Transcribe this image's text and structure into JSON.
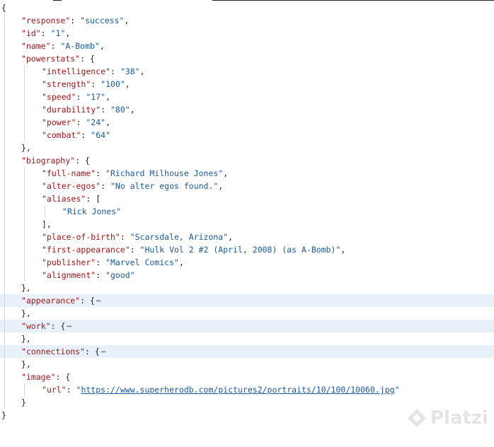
{
  "json_viewer": {
    "open_brace": "{",
    "close_brace": "}",
    "lines": [
      {
        "key": "response",
        "value": "success"
      },
      {
        "key": "id",
        "value": "1"
      },
      {
        "key": "name",
        "value": "A-Bomb"
      },
      {
        "key": "powerstats",
        "open": "{"
      },
      {
        "key": "intelligence",
        "value": "38"
      },
      {
        "key": "strength",
        "value": "100"
      },
      {
        "key": "speed",
        "value": "17"
      },
      {
        "key": "durability",
        "value": "80"
      },
      {
        "key": "power",
        "value": "24"
      },
      {
        "key": "combat",
        "value": "64"
      },
      {
        "close": "},"
      },
      {
        "key": "biography",
        "open": "{"
      },
      {
        "key": "full-name",
        "value": "Richard Milhouse Jones"
      },
      {
        "key": "alter-egos",
        "value": "No alter egos found."
      },
      {
        "key": "aliases",
        "open": "["
      },
      {
        "value": "Rick Jones"
      },
      {
        "close": "],"
      },
      {
        "key": "place-of-birth",
        "value": "Scarsdale, Arizona"
      },
      {
        "key": "first-appearance",
        "value": "Hulk Vol 2 #2 (April, 2008) (as A-Bomb)"
      },
      {
        "key": "publisher",
        "value": "Marvel Comics"
      },
      {
        "key": "alignment",
        "value": "good"
      },
      {
        "close": "},"
      },
      {
        "key": "appearance",
        "collapsed": "{",
        "ellipsis": "⋯"
      },
      {
        "close": "},"
      },
      {
        "key": "work",
        "collapsed": "{",
        "ellipsis": "⋯"
      },
      {
        "close": "},"
      },
      {
        "key": "connections",
        "collapsed": "{",
        "ellipsis": "⋯"
      },
      {
        "close": "},"
      },
      {
        "key": "image",
        "open": "{"
      },
      {
        "key": "url",
        "value": "https://www.superherodb.com/pictures2/portraits/10/100/10060.jpg"
      },
      {
        "close": "}"
      }
    ]
  },
  "watermark": {
    "text": "Platzi",
    "icon": "platzi-logo-icon"
  },
  "colors": {
    "key": "#a31515",
    "string": "#1a5aa0",
    "highlight": "#e8f1fa",
    "guide": "#d6d6d6"
  }
}
